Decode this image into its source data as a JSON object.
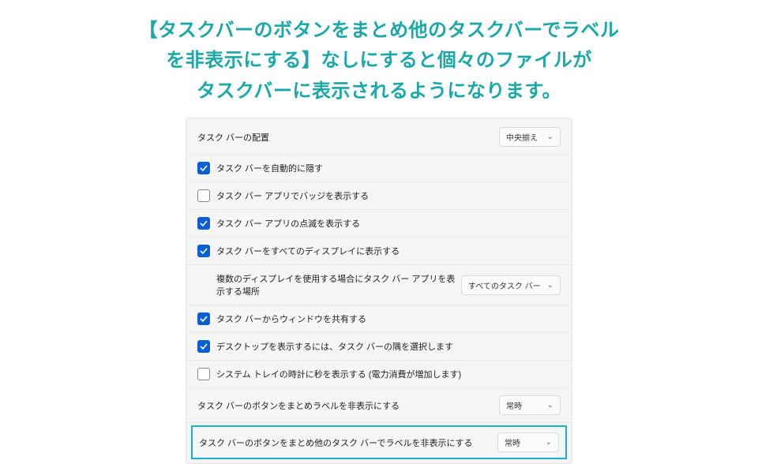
{
  "heading_line1": "【タスクバーのボタンをまとめ他のタスクバーでラベル",
  "heading_line2": "を非表示にする】なしにすると個々のファイルが",
  "heading_line3": "タスクバーに表示されるようになります。",
  "settings": {
    "alignment": {
      "label": "タスク バーの配置",
      "value": "中央揃え"
    },
    "auto_hide": {
      "label": "タスク バーを自動的に隠す",
      "checked": true
    },
    "badges": {
      "label": "タスク バー アプリでバッジを表示する",
      "checked": false
    },
    "flashing": {
      "label": "タスク バー アプリの点滅を表示する",
      "checked": true
    },
    "all_displays": {
      "label": "タスク バーをすべてのディスプレイに表示する",
      "checked": true
    },
    "multi_display_apps": {
      "label": "複数のディスプレイを使用する場合にタスク バー アプリを表示する場所",
      "value": "すべてのタスク バー"
    },
    "share_window": {
      "label": "タスク バーからウィンドウを共有する",
      "checked": true
    },
    "show_desktop": {
      "label": "デスクトップを表示するには、タスク バーの隅を選択します",
      "checked": true
    },
    "tray_seconds": {
      "label": "システム トレイの時計に秒を表示する (電力消費が増加します)",
      "checked": false
    },
    "combine_main": {
      "label": "タスク バーのボタンをまとめラベルを非表示にする",
      "value": "常時"
    },
    "combine_other": {
      "label": "タスク バーのボタンをまとめ他のタスク バーでラベルを非表示にする",
      "value": "常時"
    }
  }
}
